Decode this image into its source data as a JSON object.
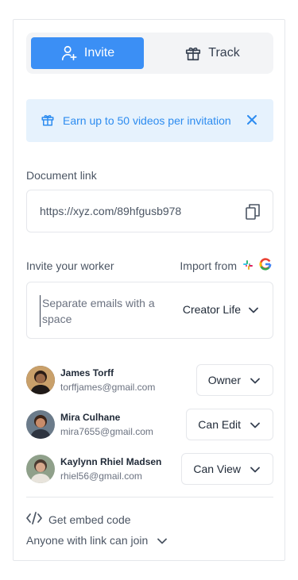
{
  "tabs": {
    "invite_label": "Invite",
    "track_label": "Track"
  },
  "banner": {
    "text": "Earn up to 50 videos per invitation"
  },
  "document_link": {
    "label": "Document link",
    "value": "https://xyz.com/89hfgusb978"
  },
  "invite": {
    "label": "Invite your worker",
    "import_label": "Import from",
    "placeholder": "Separate emails with a space",
    "role_value": "Creator Life"
  },
  "members": [
    {
      "name": "James Torff",
      "email": "torffjames@gmail.com",
      "permission": "Owner"
    },
    {
      "name": "Mira Culhane",
      "email": "mira7655@gmail.com",
      "permission": "Can Edit"
    },
    {
      "name": "Kaylynn Rhiel Madsen",
      "email": "rhiel56@gmail.com",
      "permission": "Can View"
    }
  ],
  "footer": {
    "embed_label": "Get embed code",
    "access_label": "Anyone with link can join"
  },
  "colors": {
    "accent": "#3b8ff5",
    "banner_bg": "#e6f2fd",
    "banner_text": "#2d8cf0",
    "border": "#e5e7eb"
  },
  "icons": {
    "invite_tab": "user-plus-icon",
    "track_tab": "gift-icon",
    "banner": "gift-icon",
    "banner_close": "close-icon",
    "copy": "copy-icon",
    "import_sources": [
      "slack-icon",
      "google-icon"
    ],
    "dropdown": "chevron-down-icon",
    "embed": "code-icon"
  }
}
